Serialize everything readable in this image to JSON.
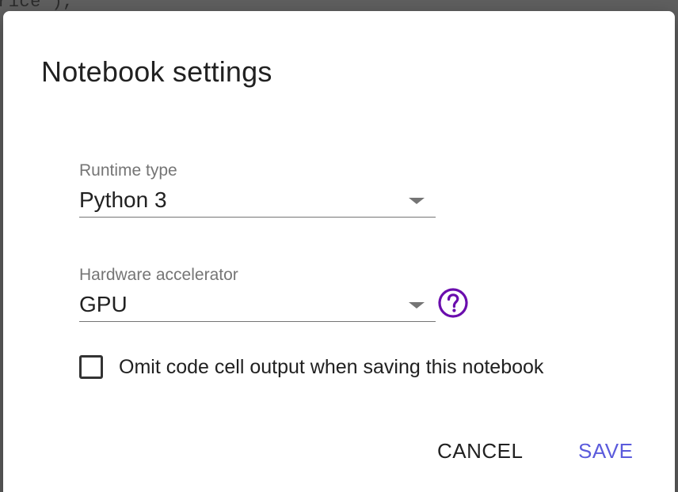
{
  "background": {
    "code_fragment": "rice'),"
  },
  "dialog": {
    "title": "Notebook settings",
    "runtime_type": {
      "label": "Runtime type",
      "value": "Python 3"
    },
    "hardware_accelerator": {
      "label": "Hardware accelerator",
      "value": "GPU",
      "help_icon": "help-circle-icon"
    },
    "omit_output_checkbox": {
      "label": "Omit code cell output when saving this notebook",
      "checked": false
    },
    "buttons": {
      "cancel": "CANCEL",
      "save": "SAVE"
    }
  },
  "colors": {
    "accent": "#5b5bdc",
    "help_icon": "#6a0dad",
    "backdrop": "#5f5f5f"
  }
}
